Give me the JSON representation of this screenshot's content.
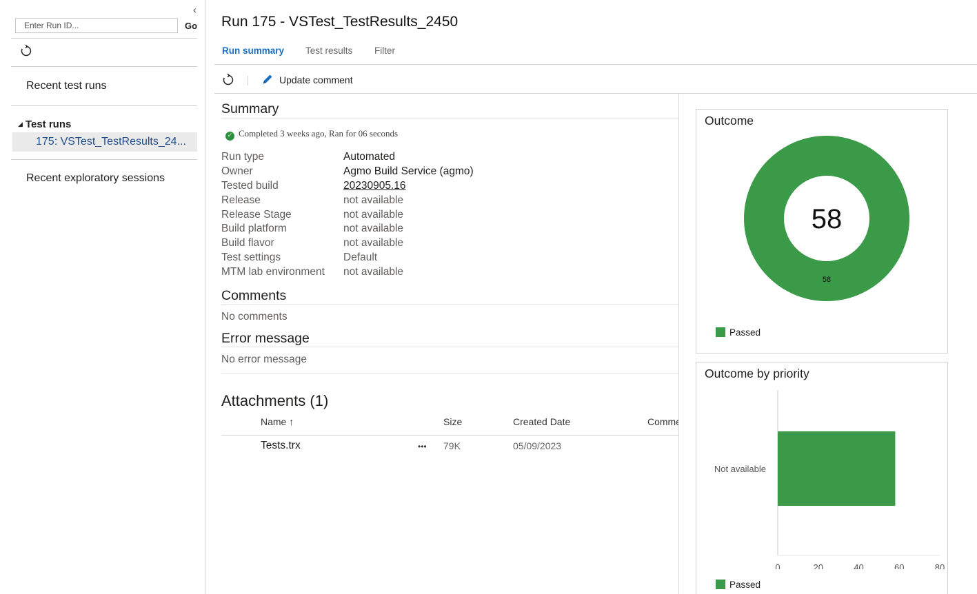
{
  "left_pane": {
    "collapse_glyph": "‹",
    "run_id_placeholder": "Enter Run ID...",
    "go_label": "Go",
    "recent_test_runs": "Recent test runs",
    "test_runs_header": "Test runs",
    "selected_run": "175: VSTest_TestResults_24...",
    "recent_exploratory": "Recent exploratory sessions"
  },
  "header": {
    "title": "Run 175 - VSTest_TestResults_2450",
    "tabs": [
      {
        "label": "Run summary",
        "active": true
      },
      {
        "label": "Test results",
        "active": false
      },
      {
        "label": "Filter",
        "active": false
      }
    ]
  },
  "toolbar": {
    "update_comment": "Update comment"
  },
  "summary": {
    "heading": "Summary",
    "status": "Completed 3 weeks ago, Ran for 06 seconds",
    "fields": [
      {
        "key": "Run type",
        "value": "Automated"
      },
      {
        "key": "Owner",
        "value": "Agmo Build Service (agmo)"
      },
      {
        "key": "Tested build",
        "value": "20230905.16"
      },
      {
        "key": "Release",
        "value": "not available"
      },
      {
        "key": "Release Stage",
        "value": "not available"
      },
      {
        "key": "Build platform",
        "value": "not available"
      },
      {
        "key": "Build flavor",
        "value": "not available"
      },
      {
        "key": "Test settings",
        "value": "Default"
      },
      {
        "key": "MTM lab environment",
        "value": "not available"
      }
    ]
  },
  "comments": {
    "heading": "Comments",
    "text": "No comments"
  },
  "error_message": {
    "heading": "Error message",
    "text": "No error message"
  },
  "attachments": {
    "title": "Attachments (1)",
    "columns": [
      "Name ↑",
      "Size",
      "Created Date",
      "Comme"
    ],
    "rows": [
      {
        "name": "Tests.trx",
        "more": "•••",
        "size": "79K",
        "created": "05/09/2023"
      }
    ]
  },
  "colors": {
    "accent": "#1a6fc4",
    "passed": "#3a9a47"
  },
  "chart_data": [
    {
      "type": "pie",
      "title": "Outcome",
      "center_label": "58",
      "categories": [
        "Passed"
      ],
      "values": [
        58
      ],
      "data_labels": [
        "58"
      ],
      "legend": [
        "Passed"
      ],
      "legend_placement": "bottom-left",
      "colors": [
        "#3a9a47"
      ]
    },
    {
      "type": "bar",
      "orientation": "horizontal",
      "title": "Outcome by priority",
      "categories": [
        "Not available"
      ],
      "series": [
        {
          "name": "Passed",
          "values": [
            58
          ]
        }
      ],
      "xlim": [
        0,
        80
      ],
      "xticks": [
        "0",
        "20",
        "40",
        "60",
        "80"
      ],
      "legend": [
        "Passed"
      ],
      "legend_placement": "bottom-left",
      "colors": [
        "#3a9a47"
      ]
    }
  ]
}
